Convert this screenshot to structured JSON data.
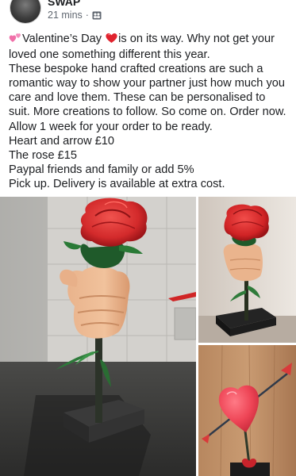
{
  "post": {
    "group_name": "SWAP",
    "timestamp": "21 mins",
    "separator": "·",
    "audience_icon": "group-icon",
    "lines": {
      "l1_a": "Valentine’s Day ",
      "l1_b": "is on its way. Why not get your",
      "l2": "loved one something different this year.",
      "l3": "These bespoke hand crafted creations are such a",
      "l4": "romantic way to show your partner just how much you",
      "l5": "care and love them. These can be personalised to",
      "l6": "suit. More creations to follow. So come on. Order now.",
      "l7": "Allow 1 week for your order to be ready.",
      "l8": "Heart and arrow £10",
      "l9": "The rose £15",
      "l10": "Paypal friends and family or add 5%",
      "l11": "Pick up. Delivery is available at extra cost."
    },
    "emoji_icons": [
      "two-hearts-icon",
      "red-heart-icon"
    ]
  },
  "photos": [
    {
      "name": "rose-hand-photo",
      "subject": "rose-in-hand-sculpture"
    },
    {
      "name": "rose-side-photo",
      "subject": "rose-in-hand-sculpture"
    },
    {
      "name": "heart-arrow-photo",
      "subject": "heart-and-arrow-sculpture"
    }
  ]
}
